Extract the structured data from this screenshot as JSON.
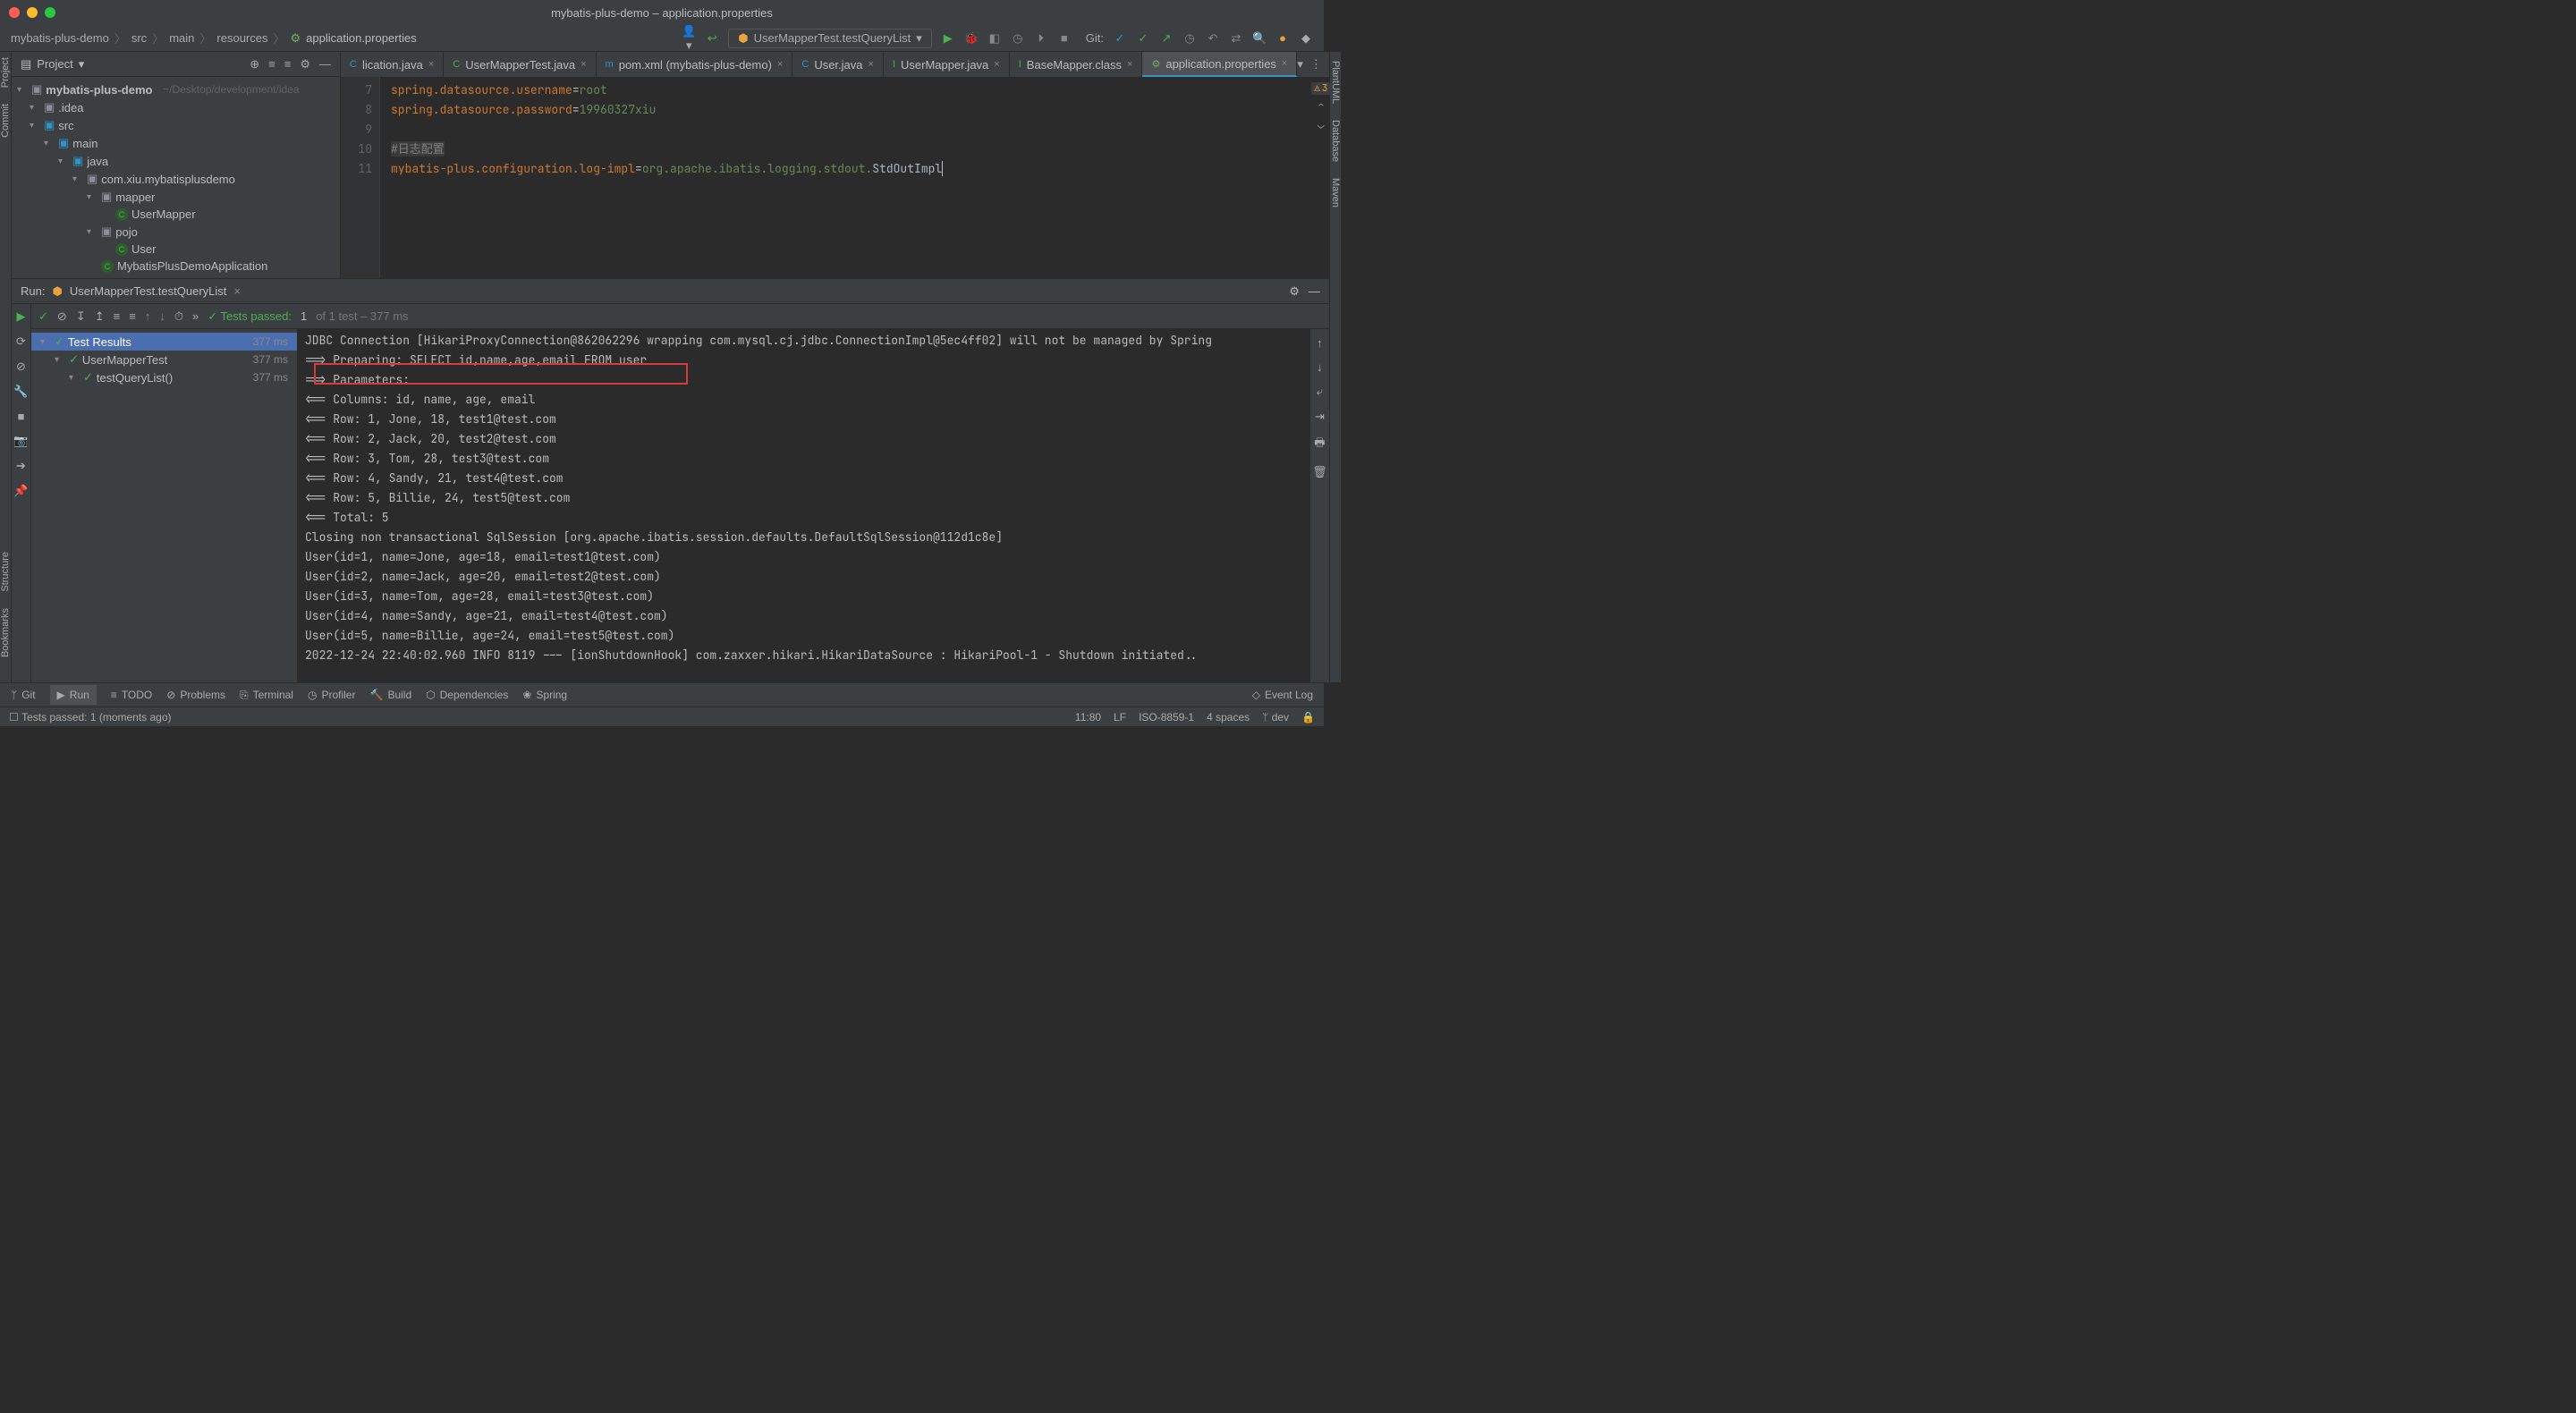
{
  "title": "mybatis-plus-demo – application.properties",
  "breadcrumb": [
    "mybatis-plus-demo",
    "src",
    "main",
    "resources",
    "application.properties"
  ],
  "run_config": "UserMapperTest.testQueryList",
  "git_label": "Git:",
  "project": {
    "label": "Project",
    "root": "mybatis-plus-demo",
    "root_path": "~/Desktop/development/idea",
    "items": [
      {
        "l": 1,
        "c": "▾",
        "i": "folder",
        "t": ".idea"
      },
      {
        "l": 1,
        "c": "▾",
        "i": "folder-blue",
        "t": "src"
      },
      {
        "l": 2,
        "c": "▾",
        "i": "folder-blue",
        "t": "main"
      },
      {
        "l": 3,
        "c": "▾",
        "i": "folder-blue",
        "t": "java"
      },
      {
        "l": 4,
        "c": "▾",
        "i": "folder",
        "t": "com.xiu.mybatisplusdemo"
      },
      {
        "l": 5,
        "c": "▾",
        "i": "folder",
        "t": "mapper"
      },
      {
        "l": 6,
        "c": "",
        "i": "class",
        "t": "UserMapper"
      },
      {
        "l": 5,
        "c": "▾",
        "i": "folder",
        "t": "pojo"
      },
      {
        "l": 6,
        "c": "",
        "i": "class",
        "t": "User"
      },
      {
        "l": 5,
        "c": "",
        "i": "class",
        "t": "MybatisPlusDemoApplication"
      }
    ]
  },
  "tabs": [
    {
      "label": "lication.java",
      "icon": "C",
      "color": "#3592c4"
    },
    {
      "label": "UserMapperTest.java",
      "icon": "C",
      "color": "#4caf50"
    },
    {
      "label": "pom.xml (mybatis-plus-demo)",
      "icon": "m",
      "color": "#3592c4"
    },
    {
      "label": "User.java",
      "icon": "C",
      "color": "#3592c4"
    },
    {
      "label": "UserMapper.java",
      "icon": "I",
      "color": "#4caf50"
    },
    {
      "label": "BaseMapper.class",
      "icon": "I",
      "color": "#4caf50"
    },
    {
      "label": "application.properties",
      "icon": "⚙",
      "color": "#7aa860",
      "active": true
    }
  ],
  "warn_count": "3",
  "editor": {
    "start": 7,
    "lines": [
      {
        "n": 7,
        "k": "spring.datasource.username",
        "v": "root"
      },
      {
        "n": 8,
        "k": "spring.datasource.password",
        "v": "19960327xiu"
      },
      {
        "n": 9,
        "blank": true
      },
      {
        "n": 10,
        "comment": "#日志配置"
      },
      {
        "n": 11,
        "k": "mybatis-plus.configuration.log-impl",
        "v": "org.apache.ibatis.logging.stdout.",
        "v2": "StdOutImpl",
        "cursor": true
      }
    ]
  },
  "run": {
    "label": "Run:",
    "name": "UserMapperTest.testQueryList",
    "tests_summary": {
      "prefix": "✓ Tests passed:",
      "count": "1",
      "of": "of 1 test – 377 ms"
    },
    "tree": [
      {
        "l": 0,
        "t": "Test Results",
        "time": "377 ms",
        "sel": true
      },
      {
        "l": 1,
        "t": "UserMapperTest",
        "time": "377 ms"
      },
      {
        "l": 2,
        "t": "testQueryList()",
        "time": "377 ms"
      }
    ],
    "console": [
      "JDBC Connection [HikariProxyConnection@862062296 wrapping com.mysql.cj.jdbc.ConnectionImpl@5ec4ff02] will not be managed by Spring",
      "==>  Preparing: SELECT id,name,age,email FROM user",
      "==> Parameters: ",
      "<==    Columns: id, name, age, email",
      "<==        Row: 1, Jone, 18, test1@test.com",
      "<==        Row: 2, Jack, 20, test2@test.com",
      "<==        Row: 3, Tom, 28, test3@test.com",
      "<==        Row: 4, Sandy, 21, test4@test.com",
      "<==        Row: 5, Billie, 24, test5@test.com",
      "<==      Total: 5",
      "Closing non transactional SqlSession [org.apache.ibatis.session.defaults.DefaultSqlSession@112d1c8e]",
      "User(id=1, name=Jone, age=18, email=test1@test.com)",
      "User(id=2, name=Jack, age=20, email=test2@test.com)",
      "User(id=3, name=Tom, age=28, email=test3@test.com)",
      "User(id=4, name=Sandy, age=21, email=test4@test.com)",
      "User(id=5, name=Billie, age=24, email=test5@test.com)",
      "2022-12-24 22:40:02.960  INFO 8119 --- [ionShutdownHook] com.zaxxer.hikari.HikariDataSource       : HikariPool-1 - Shutdown initiated.."
    ]
  },
  "bottom": {
    "items": [
      "Git",
      "Run",
      "TODO",
      "Problems",
      "Terminal",
      "Profiler",
      "Build",
      "Dependencies",
      "Spring"
    ],
    "event": "Event Log"
  },
  "status": {
    "msg": "Tests passed: 1 (moments ago)",
    "right": [
      "11:80",
      "LF",
      "ISO-8859-1",
      "4 spaces",
      "dev"
    ]
  },
  "sidetabs": {
    "left": [
      "Project",
      "Commit",
      "Structure",
      "Bookmarks"
    ],
    "right": [
      "PlantUML",
      "Database",
      "Maven"
    ]
  }
}
